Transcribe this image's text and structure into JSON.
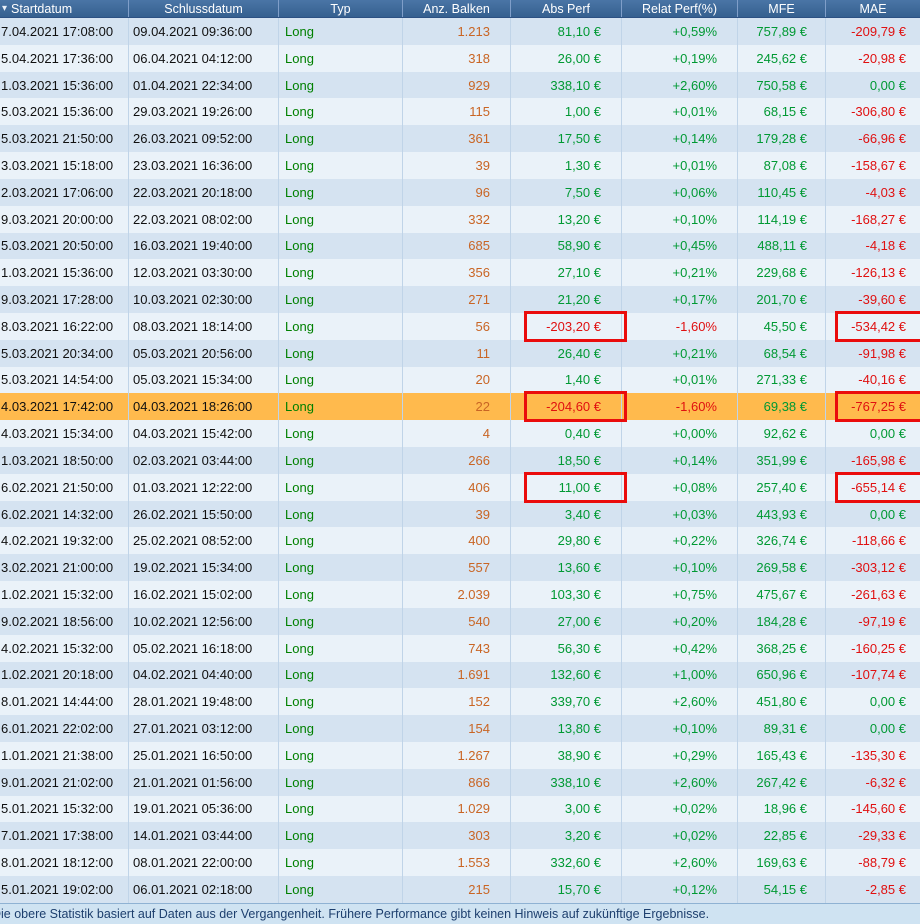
{
  "header": {
    "sort_icon": "▾",
    "columns": [
      "Startdatum",
      "Schlussdatum",
      "Typ",
      "Anz. Balken",
      "Abs Perf",
      "Relat Perf(%)",
      "MFE",
      "MAE"
    ]
  },
  "table": {
    "rows": [
      {
        "start": "7.04.2021 17:08:00",
        "end": "09.04.2021 09:36:00",
        "typ": "Long",
        "bars": "1.213",
        "abs": "81,10 €",
        "rel": "+0,59%",
        "mfe": "757,89 €",
        "mae": "-209,79 €"
      },
      {
        "start": "5.04.2021 17:36:00",
        "end": "06.04.2021 04:12:00",
        "typ": "Long",
        "bars": "318",
        "abs": "26,00 €",
        "rel": "+0,19%",
        "mfe": "245,62 €",
        "mae": "-20,98 €"
      },
      {
        "start": "1.03.2021 15:36:00",
        "end": "01.04.2021 22:34:00",
        "typ": "Long",
        "bars": "929",
        "abs": "338,10 €",
        "rel": "+2,60%",
        "mfe": "750,58 €",
        "mae": "0,00 €"
      },
      {
        "start": "5.03.2021 15:36:00",
        "end": "29.03.2021 19:26:00",
        "typ": "Long",
        "bars": "115",
        "abs": "1,00 €",
        "rel": "+0,01%",
        "mfe": "68,15 €",
        "mae": "-306,80 €"
      },
      {
        "start": "5.03.2021 21:50:00",
        "end": "26.03.2021 09:52:00",
        "typ": "Long",
        "bars": "361",
        "abs": "17,50 €",
        "rel": "+0,14%",
        "mfe": "179,28 €",
        "mae": "-66,96 €"
      },
      {
        "start": "3.03.2021 15:18:00",
        "end": "23.03.2021 16:36:00",
        "typ": "Long",
        "bars": "39",
        "abs": "1,30 €",
        "rel": "+0,01%",
        "mfe": "87,08 €",
        "mae": "-158,67 €"
      },
      {
        "start": "2.03.2021 17:06:00",
        "end": "22.03.2021 20:18:00",
        "typ": "Long",
        "bars": "96",
        "abs": "7,50 €",
        "rel": "+0,06%",
        "mfe": "110,45 €",
        "mae": "-4,03 €"
      },
      {
        "start": "9.03.2021 20:00:00",
        "end": "22.03.2021 08:02:00",
        "typ": "Long",
        "bars": "332",
        "abs": "13,20 €",
        "rel": "+0,10%",
        "mfe": "114,19 €",
        "mae": "-168,27 €"
      },
      {
        "start": "5.03.2021 20:50:00",
        "end": "16.03.2021 19:40:00",
        "typ": "Long",
        "bars": "685",
        "abs": "58,90 €",
        "rel": "+0,45%",
        "mfe": "488,11 €",
        "mae": "-4,18 €"
      },
      {
        "start": "1.03.2021 15:36:00",
        "end": "12.03.2021 03:30:00",
        "typ": "Long",
        "bars": "356",
        "abs": "27,10 €",
        "rel": "+0,21%",
        "mfe": "229,68 €",
        "mae": "-126,13 €"
      },
      {
        "start": "9.03.2021 17:28:00",
        "end": "10.03.2021 02:30:00",
        "typ": "Long",
        "bars": "271",
        "abs": "21,20 €",
        "rel": "+0,17%",
        "mfe": "201,70 €",
        "mae": "-39,60 €"
      },
      {
        "start": "8.03.2021 16:22:00",
        "end": "08.03.2021 18:14:00",
        "typ": "Long",
        "bars": "56",
        "abs": "-203,20 €",
        "rel": "-1,60%",
        "mfe": "45,50 €",
        "mae": "-534,42 €",
        "abs_box": true,
        "mae_box": true
      },
      {
        "start": "5.03.2021 20:34:00",
        "end": "05.03.2021 20:56:00",
        "typ": "Long",
        "bars": "11",
        "abs": "26,40 €",
        "rel": "+0,21%",
        "mfe": "68,54 €",
        "mae": "-91,98 €"
      },
      {
        "start": "5.03.2021 14:54:00",
        "end": "05.03.2021 15:34:00",
        "typ": "Long",
        "bars": "20",
        "abs": "1,40 €",
        "rel": "+0,01%",
        "mfe": "271,33 €",
        "mae": "-40,16 €"
      },
      {
        "start": "4.03.2021 17:42:00",
        "end": "04.03.2021 18:26:00",
        "typ": "Long",
        "bars": "22",
        "abs": "-204,60 €",
        "rel": "-1,60%",
        "mfe": "69,38 €",
        "mae": "-767,25 €",
        "highlight": true,
        "abs_box": true,
        "mae_box": true
      },
      {
        "start": "4.03.2021 15:34:00",
        "end": "04.03.2021 15:42:00",
        "typ": "Long",
        "bars": "4",
        "abs": "0,40 €",
        "rel": "+0,00%",
        "mfe": "92,62 €",
        "mae": "0,00 €"
      },
      {
        "start": "1.03.2021 18:50:00",
        "end": "02.03.2021 03:44:00",
        "typ": "Long",
        "bars": "266",
        "abs": "18,50 €",
        "rel": "+0,14%",
        "mfe": "351,99 €",
        "mae": "-165,98 €"
      },
      {
        "start": "6.02.2021 21:50:00",
        "end": "01.03.2021 12:22:00",
        "typ": "Long",
        "bars": "406",
        "abs": "11,00 €",
        "rel": "+0,08%",
        "mfe": "257,40 €",
        "mae": "-655,14 €",
        "abs_box": true,
        "mae_box": true
      },
      {
        "start": "6.02.2021 14:32:00",
        "end": "26.02.2021 15:50:00",
        "typ": "Long",
        "bars": "39",
        "abs": "3,40 €",
        "rel": "+0,03%",
        "mfe": "443,93 €",
        "mae": "0,00 €"
      },
      {
        "start": "4.02.2021 19:32:00",
        "end": "25.02.2021 08:52:00",
        "typ": "Long",
        "bars": "400",
        "abs": "29,80 €",
        "rel": "+0,22%",
        "mfe": "326,74 €",
        "mae": "-118,66 €"
      },
      {
        "start": "3.02.2021 21:00:00",
        "end": "19.02.2021 15:34:00",
        "typ": "Long",
        "bars": "557",
        "abs": "13,60 €",
        "rel": "+0,10%",
        "mfe": "269,58 €",
        "mae": "-303,12 €"
      },
      {
        "start": "1.02.2021 15:32:00",
        "end": "16.02.2021 15:02:00",
        "typ": "Long",
        "bars": "2.039",
        "abs": "103,30 €",
        "rel": "+0,75%",
        "mfe": "475,67 €",
        "mae": "-261,63 €"
      },
      {
        "start": "9.02.2021 18:56:00",
        "end": "10.02.2021 12:56:00",
        "typ": "Long",
        "bars": "540",
        "abs": "27,00 €",
        "rel": "+0,20%",
        "mfe": "184,28 €",
        "mae": "-97,19 €"
      },
      {
        "start": "4.02.2021 15:32:00",
        "end": "05.02.2021 16:18:00",
        "typ": "Long",
        "bars": "743",
        "abs": "56,30 €",
        "rel": "+0,42%",
        "mfe": "368,25 €",
        "mae": "-160,25 €"
      },
      {
        "start": "1.02.2021 20:18:00",
        "end": "04.02.2021 04:40:00",
        "typ": "Long",
        "bars": "1.691",
        "abs": "132,60 €",
        "rel": "+1,00%",
        "mfe": "650,96 €",
        "mae": "-107,74 €"
      },
      {
        "start": "8.01.2021 14:44:00",
        "end": "28.01.2021 19:48:00",
        "typ": "Long",
        "bars": "152",
        "abs": "339,70 €",
        "rel": "+2,60%",
        "mfe": "451,80 €",
        "mae": "0,00 €"
      },
      {
        "start": "6.01.2021 22:02:00",
        "end": "27.01.2021 03:12:00",
        "typ": "Long",
        "bars": "154",
        "abs": "13,80 €",
        "rel": "+0,10%",
        "mfe": "89,31 €",
        "mae": "0,00 €"
      },
      {
        "start": "1.01.2021 21:38:00",
        "end": "25.01.2021 16:50:00",
        "typ": "Long",
        "bars": "1.267",
        "abs": "38,90 €",
        "rel": "+0,29%",
        "mfe": "165,43 €",
        "mae": "-135,30 €"
      },
      {
        "start": "9.01.2021 21:02:00",
        "end": "21.01.2021 01:56:00",
        "typ": "Long",
        "bars": "866",
        "abs": "338,10 €",
        "rel": "+2,60%",
        "mfe": "267,42 €",
        "mae": "-6,32 €"
      },
      {
        "start": "5.01.2021 15:32:00",
        "end": "19.01.2021 05:36:00",
        "typ": "Long",
        "bars": "1.029",
        "abs": "3,00 €",
        "rel": "+0,02%",
        "mfe": "18,96 €",
        "mae": "-145,60 €"
      },
      {
        "start": "7.01.2021 17:38:00",
        "end": "14.01.2021 03:44:00",
        "typ": "Long",
        "bars": "303",
        "abs": "3,20 €",
        "rel": "+0,02%",
        "mfe": "22,85 €",
        "mae": "-29,33 €"
      },
      {
        "start": "8.01.2021 18:12:00",
        "end": "08.01.2021 22:00:00",
        "typ": "Long",
        "bars": "1.553",
        "abs": "332,60 €",
        "rel": "+2,60%",
        "mfe": "169,63 €",
        "mae": "-88,79 €"
      },
      {
        "start": "5.01.2021 19:02:00",
        "end": "06.01.2021 02:18:00",
        "typ": "Long",
        "bars": "215",
        "abs": "15,70 €",
        "rel": "+0,12%",
        "mfe": "54,15 €",
        "mae": "-2,85 €"
      }
    ]
  },
  "statusbar": {
    "text": "Die obere Statistik basiert auf Daten aus der Vergangenheit. Frühere Performance gibt keinen Hinweis auf zukünftige Ergebnisse."
  },
  "colors": {
    "highlight": "#ffba4d",
    "typ": "#008000",
    "bars": "#c96524",
    "positive": "#009933",
    "negative": "#e01010",
    "annotation": "#ea0c0c"
  }
}
